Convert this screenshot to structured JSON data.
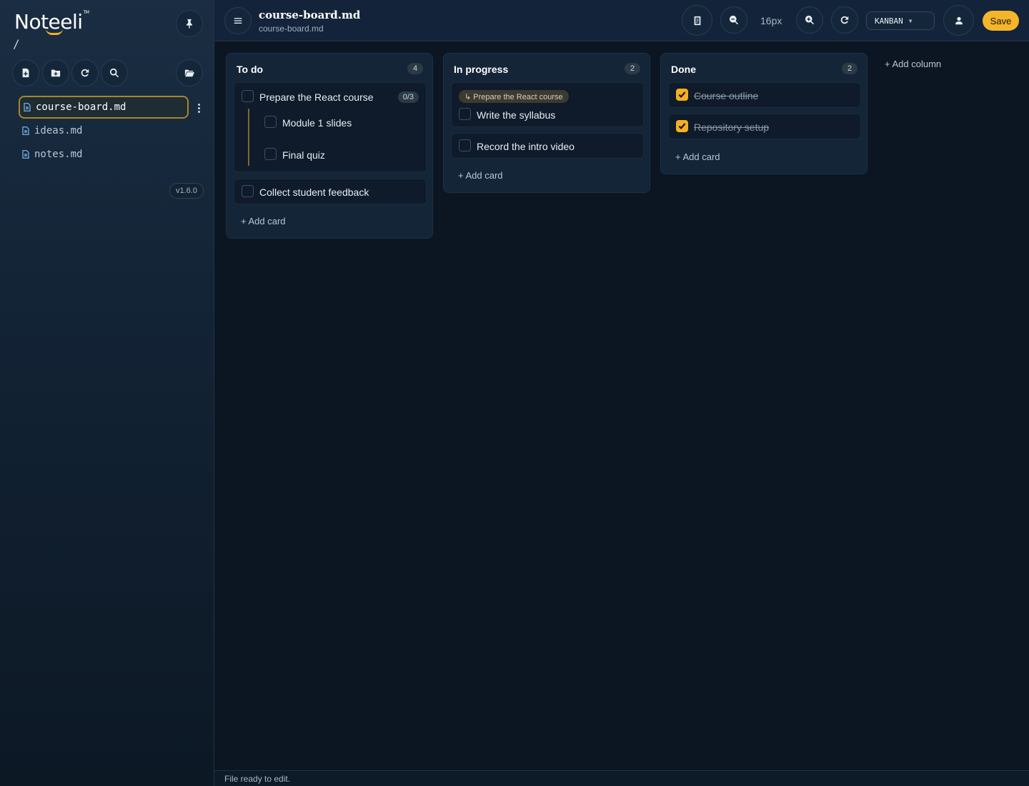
{
  "sidebar": {
    "logo": "Noteeli",
    "logo_tm": "TM",
    "path": "/",
    "files": [
      {
        "name": "course-board.md",
        "active": true
      },
      {
        "name": "ideas.md"
      },
      {
        "name": "notes.md"
      }
    ],
    "version": "v1.6.0"
  },
  "header": {
    "title": "course-board.md",
    "subtitle": "course-board.md",
    "font_size": "16px",
    "mode": "KANBAN",
    "save_label": "Save"
  },
  "board": {
    "columns": [
      {
        "title": "To do",
        "count": "4",
        "cards": [
          {
            "text": "Prepare the React course",
            "progress": "0/3",
            "subtasks": [
              {
                "text": "Module 1 slides"
              },
              {
                "text": "Final quiz"
              }
            ]
          },
          {
            "text": "Collect student feedback"
          }
        ],
        "add_card": "+ Add card"
      },
      {
        "title": "In progress",
        "count": "2",
        "cards": [
          {
            "parent": "↳ Prepare the React course",
            "text": "Write the syllabus"
          },
          {
            "text": "Record the intro video"
          }
        ],
        "add_card": "+ Add card"
      },
      {
        "title": "Done",
        "count": "2",
        "cards": [
          {
            "text": "Course outline",
            "checked": true
          },
          {
            "text": "Repository setup",
            "checked": true
          }
        ],
        "add_card": "+ Add card"
      }
    ],
    "add_column": "+ Add column"
  },
  "status": "File ready to edit.",
  "colors": {
    "accent": "#f5b52a",
    "background": "#0b1622",
    "sidebar": "#142538"
  },
  "icons": [
    "pin-icon",
    "new-file-icon",
    "new-folder-icon",
    "refresh-icon",
    "search-icon",
    "open-folder-icon",
    "menu-icon",
    "document-icon",
    "zoom-out-icon",
    "zoom-in-icon",
    "reset-icon",
    "user-icon",
    "kebab-icon"
  ]
}
